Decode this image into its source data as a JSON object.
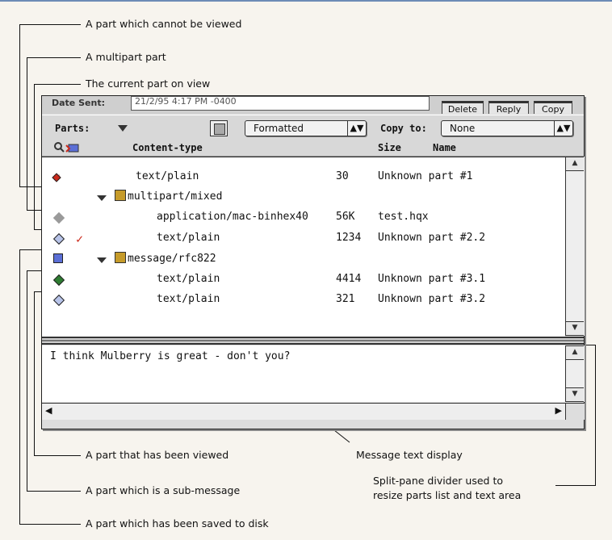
{
  "annotations": {
    "cannot_view": "A part which cannot be viewed",
    "multipart": "A multipart part",
    "current_part": "The current part on view",
    "viewed": "A part that has been viewed",
    "sub_message": "A part which is a sub-message",
    "saved": "A part which has been saved to disk",
    "message_text": "Message text display",
    "divider_line1": "Split-pane divider used to",
    "divider_line2": "resize parts list and text area"
  },
  "window": {
    "date_label": "Date Sent:",
    "date_value": "21/2/95 4:17 PM -0400",
    "delete_label": "Delete",
    "reply_label": "Reply",
    "copy_label": "Copy",
    "parts_label": "Parts:",
    "format_value": "Formatted",
    "copy_to_label": "Copy to:",
    "copy_to_value": "None",
    "columns": {
      "content_type": "Content-type",
      "size": "Size",
      "name": "Name"
    },
    "parts": [
      {
        "content_type": "text/plain",
        "size": "30",
        "name": "Unknown part #1"
      },
      {
        "content_type": "multipart/mixed",
        "size": "",
        "name": ""
      },
      {
        "content_type": "application/mac-binhex40",
        "size": "56K",
        "name": "test.hqx"
      },
      {
        "content_type": "text/plain",
        "size": "1234",
        "name": "Unknown part #2.2"
      },
      {
        "content_type": "message/rfc822",
        "size": "",
        "name": ""
      },
      {
        "content_type": "text/plain",
        "size": "4414",
        "name": "Unknown part #3.1"
      },
      {
        "content_type": "text/plain",
        "size": "321",
        "name": "Unknown part #3.2"
      }
    ],
    "message_text": "I think Mulberry is great - don't you?"
  },
  "colors": {
    "check_red": "#cc2a1c",
    "viewed_green": "#2e7d32",
    "unviewable_gray": "#9a9a9a",
    "current_blue": "#b7c3e8"
  }
}
